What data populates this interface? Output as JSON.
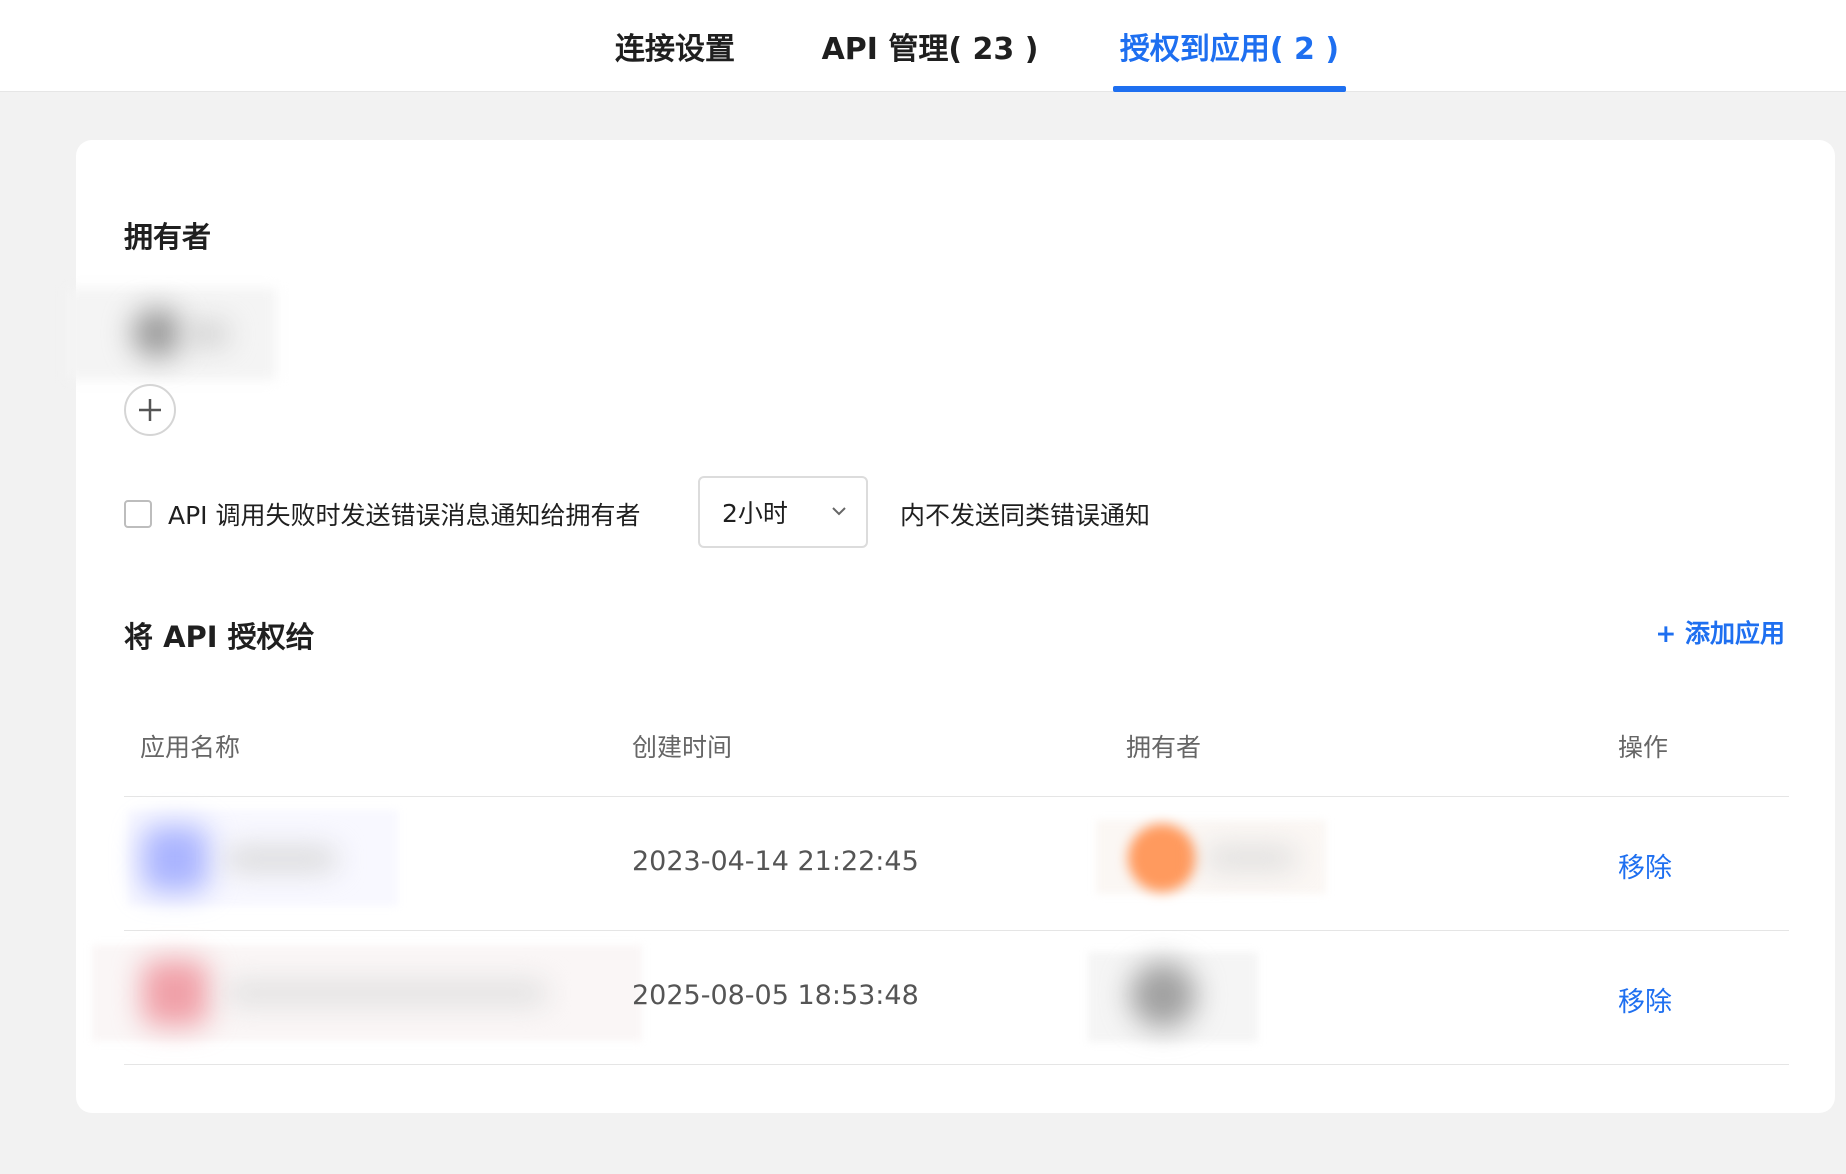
{
  "tabs": [
    {
      "label": "连接设置",
      "active": false
    },
    {
      "label": "API 管理( 23 )",
      "active": false
    },
    {
      "label": "授权到应用( 2 )",
      "active": true
    }
  ],
  "owner_section": {
    "title": "拥有者",
    "add_icon": "plus-icon"
  },
  "notify": {
    "checkbox_checked": false,
    "label": "API 调用失败时发送错误消息通知给拥有者",
    "interval_value": "2小时",
    "suffix": "内不发送同类错误通知"
  },
  "grant_section": {
    "title": "将 API 授权给",
    "add_app_label": "+ 添加应用"
  },
  "table": {
    "columns": [
      "应用名称",
      "创建时间",
      "拥有者",
      "操作"
    ],
    "rows": [
      {
        "created_at": "2023-04-14 21:22:45",
        "action": "移除"
      },
      {
        "created_at": "2025-08-05 18:53:48",
        "action": "移除"
      }
    ]
  },
  "colors": {
    "accent": "#1e6ff0",
    "background": "#f2f2f2",
    "card": "#ffffff"
  }
}
